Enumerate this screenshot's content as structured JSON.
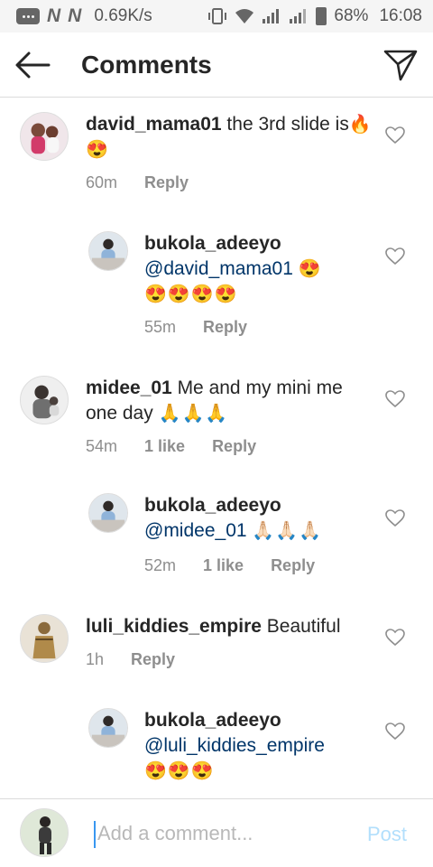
{
  "status_bar": {
    "n1": "N",
    "n2": "N",
    "speed": "0.69K/s",
    "battery": "68%",
    "time": "16:08"
  },
  "header": {
    "title": "Comments",
    "back_icon": "arrow-left-icon",
    "send_icon": "paper-plane-icon"
  },
  "comments": [
    {
      "username": "david_mama01",
      "text": " the 3rd slide is",
      "emoji": "🔥 😍",
      "time": "60m",
      "likes": "",
      "reply": "Reply",
      "avatar": "avatar-david-mama01"
    },
    {
      "username": "bukola_adeeyo",
      "mention": "@david_mama01",
      "emoji": "😍",
      "emoji2": "😍😍😍😍",
      "time": "55m",
      "likes": "",
      "reply": "Reply",
      "avatar": "avatar-bukola-adeeyo"
    },
    {
      "username": "midee_01",
      "text": " Me and my mini me one day",
      "emoji": "🙏🙏🙏",
      "time": "54m",
      "likes": "1 like",
      "reply": "Reply",
      "avatar": "avatar-midee-01"
    },
    {
      "username": "bukola_adeeyo",
      "mention": "@midee_01",
      "emoji": "🙏🏻🙏🏻🙏🏻",
      "time": "52m",
      "likes": "1 like",
      "reply": "Reply",
      "avatar": "avatar-bukola-adeeyo"
    },
    {
      "username": "luli_kiddies_empire",
      "text": " Beautiful",
      "time": "1h",
      "likes": "",
      "reply": "Reply",
      "avatar": "avatar-luli-kiddies-empire"
    },
    {
      "username": "bukola_adeeyo",
      "mention": "@luli_kiddies_empire",
      "emoji": "😍😍😍",
      "avatar": "avatar-bukola-adeeyo"
    }
  ],
  "composer": {
    "placeholder": "Add a comment...",
    "post_label": "Post"
  },
  "colors": {
    "mention": "#003569",
    "meta": "#8e8e8e",
    "post_disabled": "#b2dffc",
    "cursor": "#3897f0"
  }
}
